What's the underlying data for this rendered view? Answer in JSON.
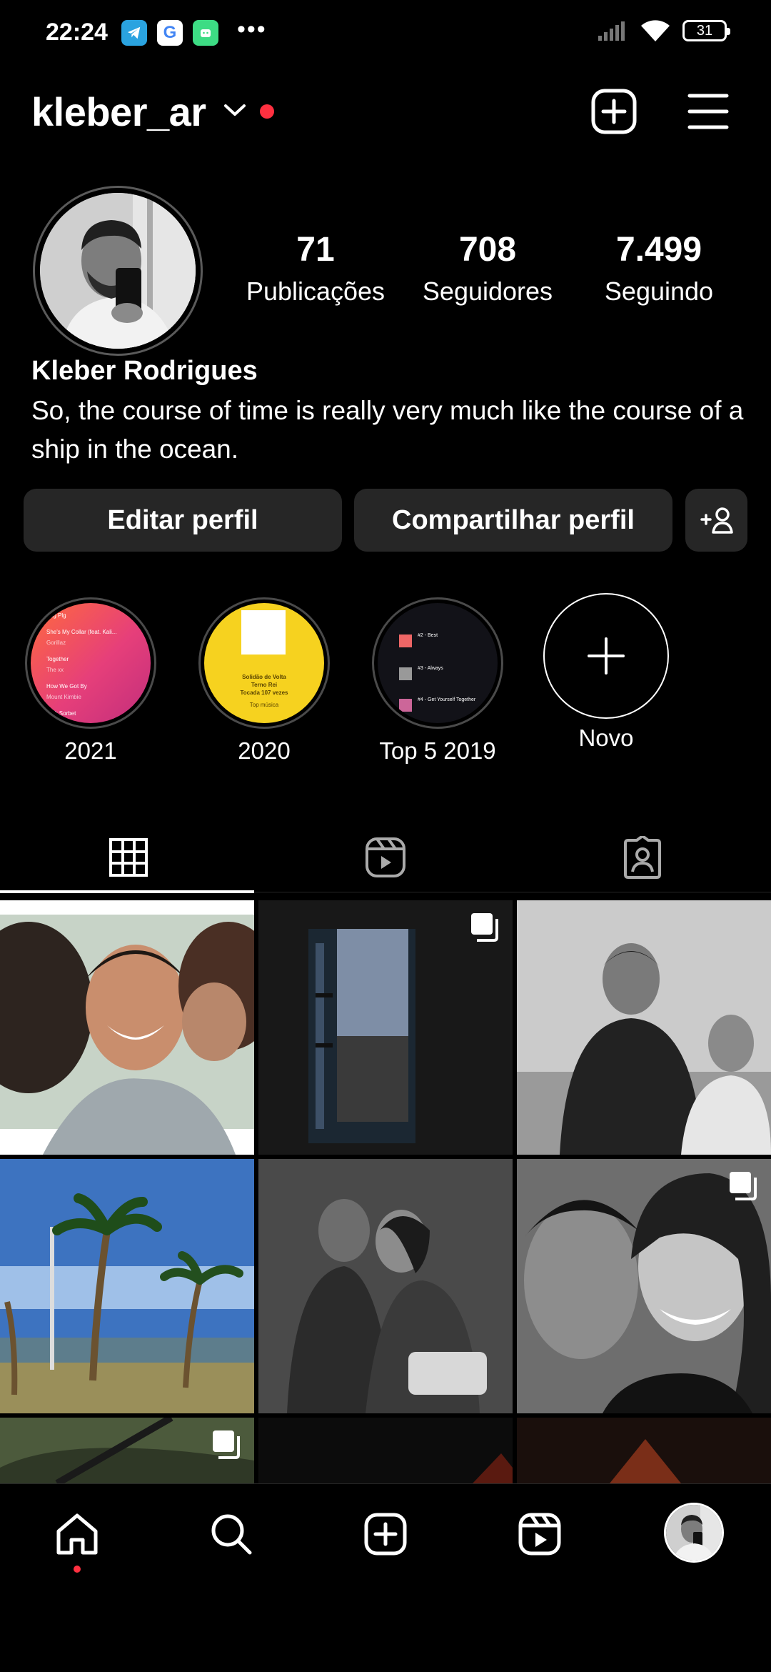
{
  "status_bar": {
    "time": "22:24",
    "apps": [
      "telegram-icon",
      "google-icon",
      "android-icon"
    ],
    "more": "•••",
    "battery": "31"
  },
  "header": {
    "username": "kleber_ar",
    "has_notification_dot": true
  },
  "profile": {
    "stats": [
      {
        "value": "71",
        "label": "Publicações"
      },
      {
        "value": "708",
        "label": "Seguidores"
      },
      {
        "value": "7.499",
        "label": "Seguindo"
      }
    ],
    "full_name": "Kleber Rodrigues",
    "bio": "So, the course of time is really very much like the course of a ship in the ocean."
  },
  "buttons": {
    "edit": "Editar perfil",
    "share": "Compartilhar perfil"
  },
  "highlights": [
    {
      "label": "2021"
    },
    {
      "label": "2020"
    },
    {
      "label": "Top 5 2019"
    },
    {
      "label": "Novo"
    }
  ],
  "highlight_thumbs": {
    "h2021": {
      "lines": [
        "Pkg Plg",
        "She's My Collar (feat. Kali...",
        "Gorillaz",
        "Together",
        "The xx",
        "How We Got By",
        "Mount Kimbie",
        "Pink Sorbet"
      ]
    },
    "h2020": {
      "lines": [
        "Solidão de Volta",
        "Terno Rei",
        "Tocada 107 vezes",
        "Top música"
      ]
    },
    "h2019": {
      "lines": [
        "#2 - Best",
        "#3 - Always",
        "#4 - Get Yourself Together"
      ]
    }
  },
  "colors": {
    "background": "#000000",
    "button": "#262626",
    "accent_red": "#ff3040"
  }
}
